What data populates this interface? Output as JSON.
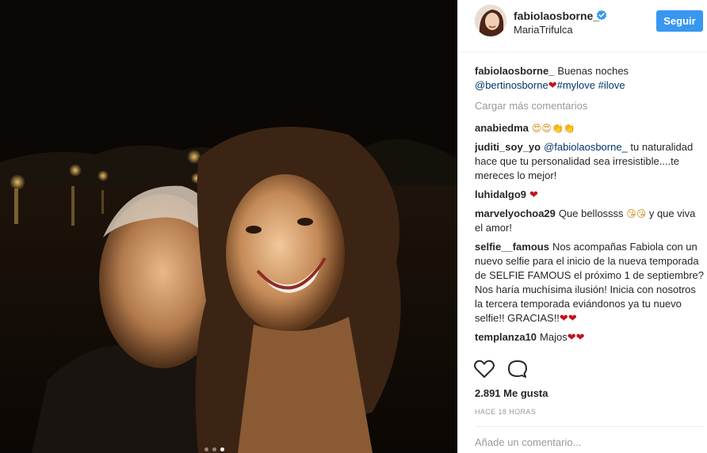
{
  "post": {
    "username": "fabiolaosborne_",
    "location": "MariaTrifulca",
    "follow_label": "Seguir",
    "verified_icon": "verified-badge-icon",
    "accent_color": "#3897f0"
  },
  "caption": {
    "username": "fabiolaosborne_",
    "text": "Buenas noches",
    "mention": "@bertinosborne",
    "heart": "❤",
    "tag1": "#mylove",
    "tag2": "#ilove"
  },
  "load_more_label": "Cargar más comentarios",
  "comments": [
    {
      "user": "anabiedma",
      "text": "😍😍👏👏"
    },
    {
      "user": "juditi_soy_yo",
      "mention": "@fabiolaosborne_",
      "text": "tu naturalidad hace que tu personalidad sea irresistible....te mereces lo mejor!"
    },
    {
      "user": "luhidalgo9",
      "text": "❤"
    },
    {
      "user": "marvelyochoa29",
      "text_a": "Que bellossss",
      "emoji": "😘😘",
      "text_b": "y que viva el amor!"
    },
    {
      "user": "selfie__famous",
      "text": "Nos acompañas Fabiola con un nuevo selfie para el inicio de la nueva temporada de SELFIE FAMOUS el próximo 1 de septiembre? Nos haría muchísima ilusión! Inicia con nosotros la tercera temporada eviándonos ya tu nuevo selfie!! GRACIAS!!",
      "hearts": "❤❤"
    },
    {
      "user": "templanza10",
      "text": "Majos",
      "hearts": "❤❤"
    }
  ],
  "actions": {
    "like_icon": "heart-outline-icon",
    "comment_icon": "comment-bubble-icon"
  },
  "likes_label": "2.891 Me gusta",
  "time_ago": "HACE 18 HORAS",
  "add_comment_placeholder": "Añade un comentario...",
  "carousel": {
    "count": 3,
    "active_index": 2
  }
}
